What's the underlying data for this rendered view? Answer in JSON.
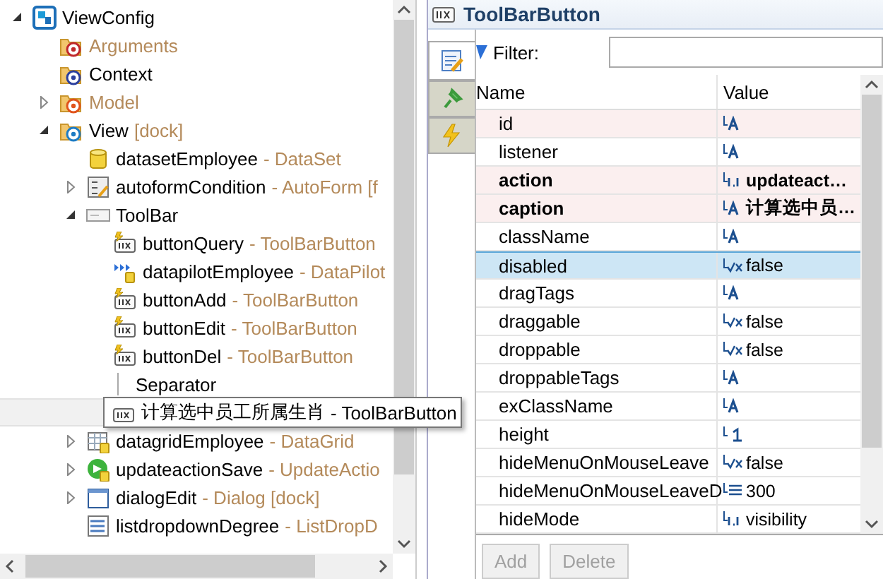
{
  "tree": [
    {
      "name": "ViewConfig",
      "kind": "viewconfig",
      "expanded": true,
      "children": [
        {
          "name": "Arguments",
          "kind": "folder-args",
          "dimmed": true
        },
        {
          "name": "Context",
          "kind": "folder-context",
          "dimmed": false
        },
        {
          "name": "Model",
          "kind": "folder-model",
          "dimmed": true,
          "expanded": false
        },
        {
          "name": "View",
          "note": "[dock]",
          "kind": "folder-view",
          "dimmed": false,
          "expanded": true,
          "children": [
            {
              "name": "datasetEmployee",
              "type": "- DataSet",
              "kind": "dataset"
            },
            {
              "name": "autoformCondition",
              "type": "- AutoForm [f",
              "kind": "autoform",
              "expanded": false
            },
            {
              "name": "ToolBar",
              "kind": "toolbar",
              "expanded": true,
              "children": [
                {
                  "name": "buttonQuery",
                  "type": "- ToolBarButton",
                  "kind": "button-bolt"
                },
                {
                  "name": "datapilotEmployee",
                  "type": "- DataPilot",
                  "kind": "datapilot"
                },
                {
                  "name": "buttonAdd",
                  "type": "- ToolBarButton",
                  "kind": "button-bolt"
                },
                {
                  "name": "buttonEdit",
                  "type": "- ToolBarButton",
                  "kind": "button-bolt"
                },
                {
                  "name": "buttonDel",
                  "type": "- ToolBarButton",
                  "kind": "button-bolt"
                },
                {
                  "name": "Separator",
                  "kind": "separator"
                },
                {
                  "name": "计算选中员工所属生肖",
                  "type": "- ToolBarButton",
                  "kind": "button",
                  "hovered": true
                }
              ]
            },
            {
              "name": "datagridEmployee",
              "type": "- DataGrid",
              "kind": "datagrid",
              "expanded": false
            },
            {
              "name": "updateactionSave",
              "type": "- UpdateActio",
              "kind": "updateaction",
              "expanded": false
            },
            {
              "name": "dialogEdit",
              "type": "- Dialog [dock]",
              "kind": "dialog",
              "expanded": false
            },
            {
              "name": "listdropdownDegree",
              "type": "- ListDropD",
              "kind": "listdropdown"
            }
          ]
        }
      ]
    }
  ],
  "inspector": {
    "title": "ToolBarButton",
    "side_tabs": [
      {
        "kind": "properties",
        "selected": true
      },
      {
        "kind": "pin",
        "selected": false
      },
      {
        "kind": "events",
        "selected": false
      }
    ],
    "filter": {
      "label": "Filter:"
    },
    "columns": [
      "Name",
      "Value"
    ],
    "properties": [
      {
        "name": "id",
        "kind": "string",
        "marked": true,
        "bold": false,
        "selected": false
      },
      {
        "name": "listener",
        "kind": "string",
        "marked": false,
        "bold": false,
        "selected": false
      },
      {
        "name": "action",
        "kind": "expression",
        "value": "updateact…",
        "marked": true,
        "bold": true,
        "selected": false
      },
      {
        "name": "caption",
        "kind": "string",
        "value": "计算选中员…",
        "marked": true,
        "bold": true,
        "selected": false
      },
      {
        "name": "className",
        "kind": "string",
        "marked": false,
        "bold": false,
        "selected": false
      },
      {
        "name": "disabled",
        "kind": "boolean",
        "value": "false",
        "marked": false,
        "bold": false,
        "selected": true
      },
      {
        "name": "dragTags",
        "kind": "string",
        "marked": false,
        "bold": false,
        "selected": false
      },
      {
        "name": "draggable",
        "kind": "boolean",
        "value": "false",
        "marked": false,
        "bold": false,
        "selected": false
      },
      {
        "name": "droppable",
        "kind": "boolean",
        "value": "false",
        "marked": false,
        "bold": false,
        "selected": false
      },
      {
        "name": "droppableTags",
        "kind": "string",
        "marked": false,
        "bold": false,
        "selected": false
      },
      {
        "name": "exClassName",
        "kind": "string",
        "marked": false,
        "bold": false,
        "selected": false
      },
      {
        "name": "height",
        "kind": "integer",
        "marked": false,
        "bold": false,
        "selected": false
      },
      {
        "name": "hideMenuOnMouseLeave",
        "kind": "boolean",
        "value": "false",
        "marked": false,
        "bold": false,
        "selected": false
      },
      {
        "name": "hideMenuOnMouseLeaveD",
        "kind": "list",
        "value": "300",
        "marked": false,
        "bold": false,
        "selected": false
      },
      {
        "name": "hideMode",
        "kind": "expression",
        "value": "visibility",
        "marked": false,
        "bold": false,
        "selected": false
      }
    ],
    "buttons": [
      {
        "label": "Add",
        "disabled": true
      },
      {
        "label": "Delete",
        "disabled": true
      }
    ]
  }
}
